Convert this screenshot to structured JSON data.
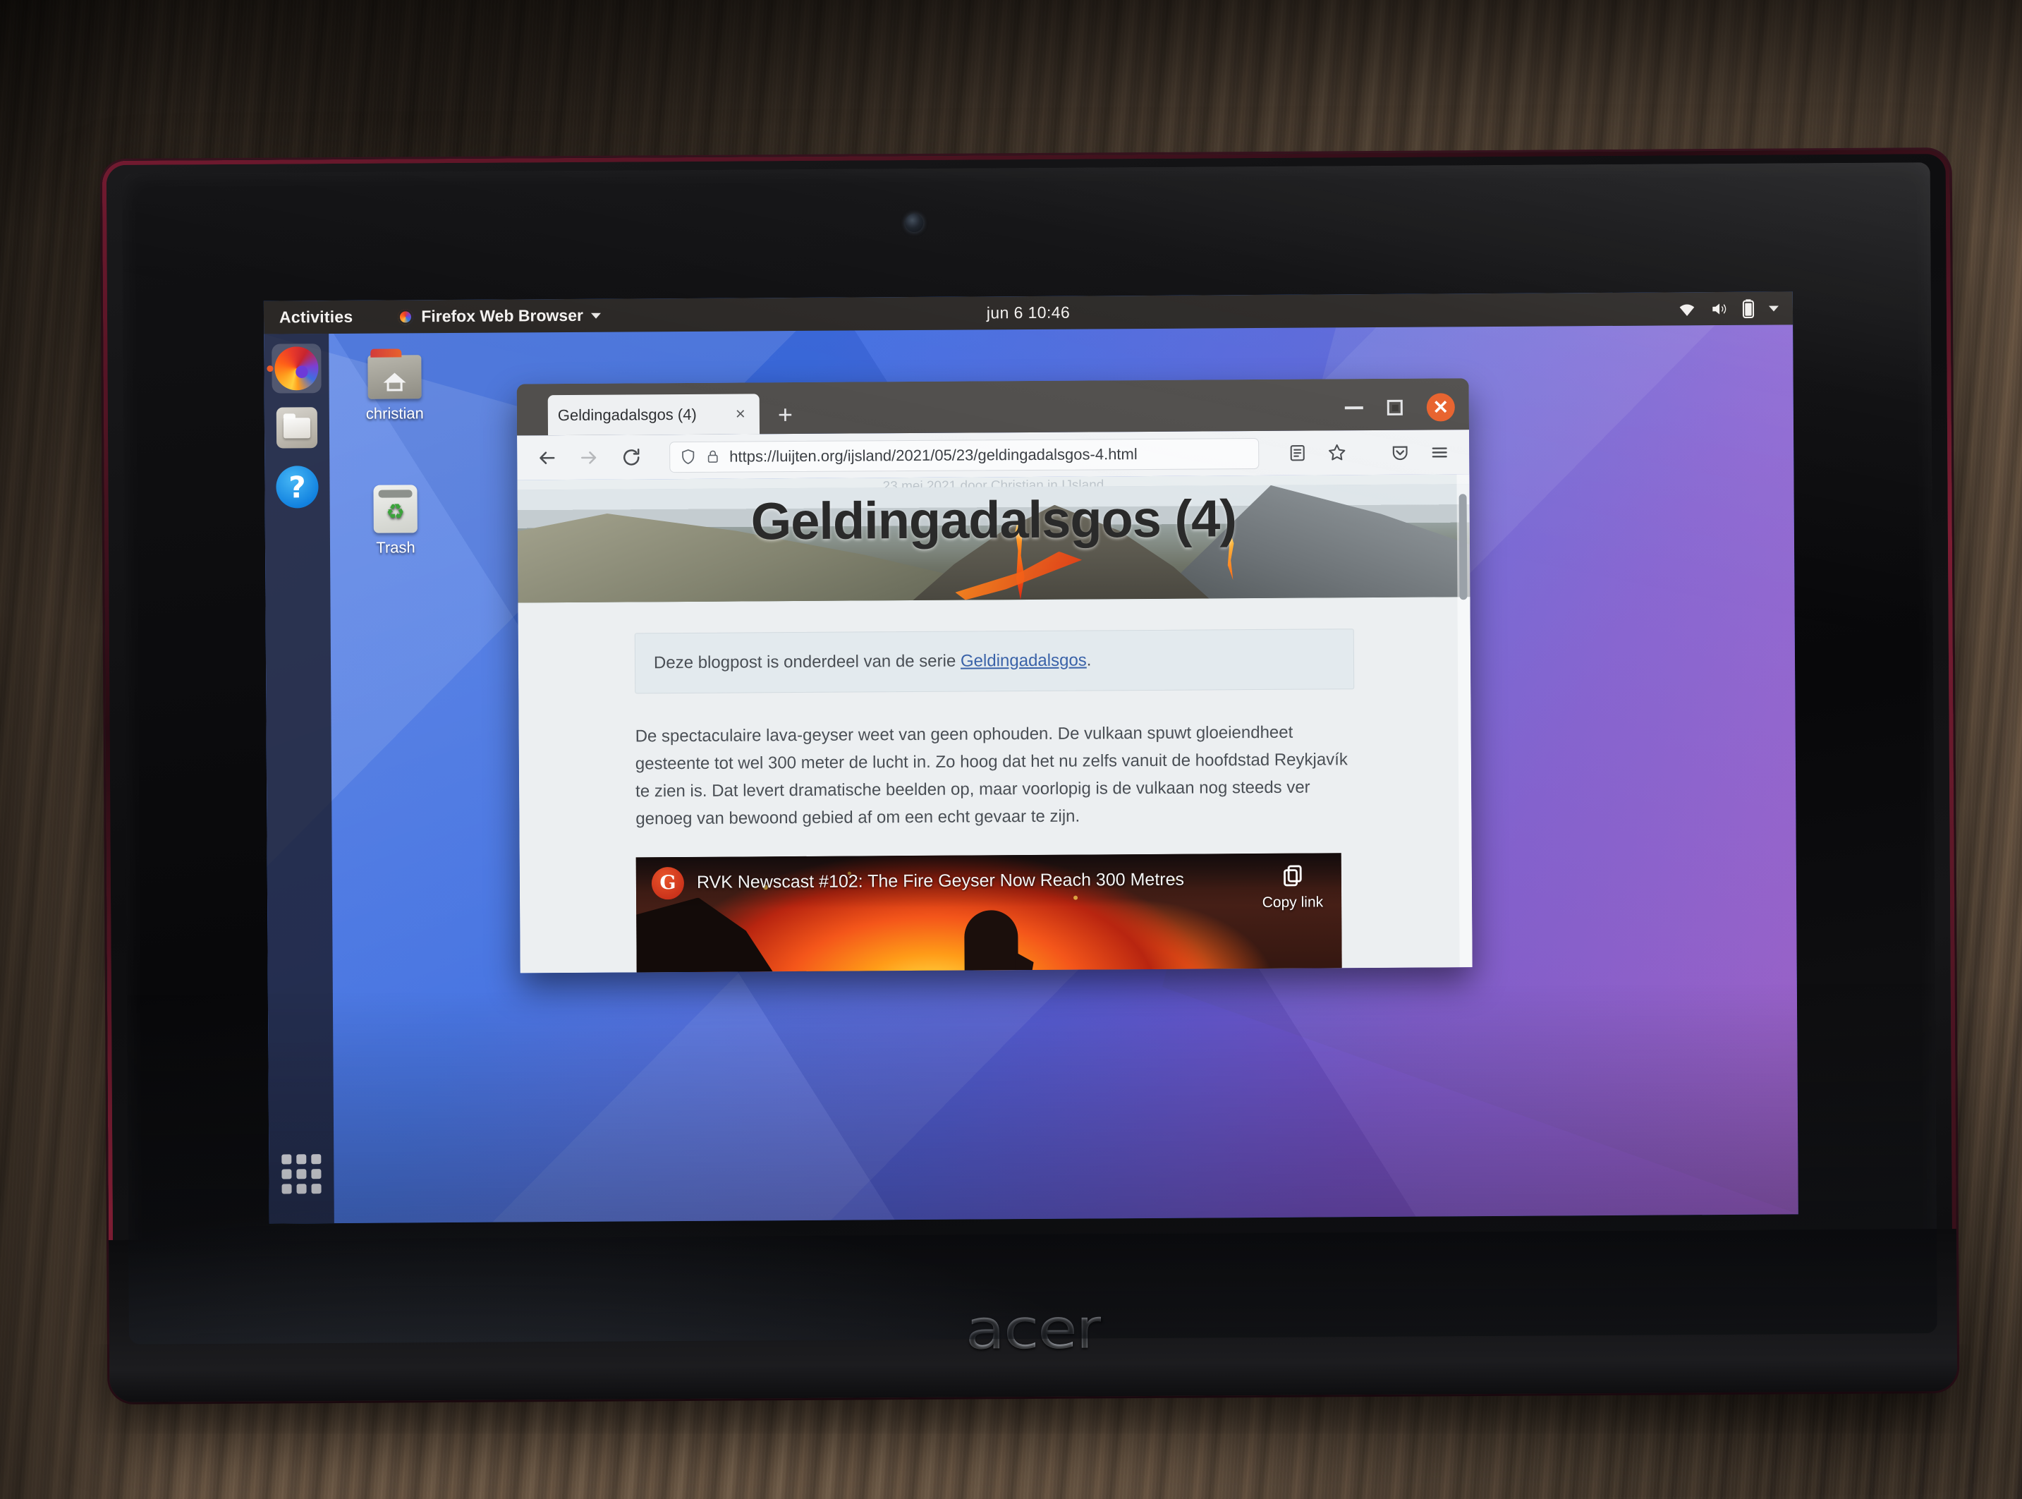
{
  "device": {
    "brand": "acer"
  },
  "desktop": {
    "topbar": {
      "activities": "Activities",
      "app_menu": "Firefox Web Browser",
      "clock": "jun 6  10:46",
      "icons": [
        "wifi-icon",
        "volume-icon",
        "battery-icon",
        "chevron-down-icon"
      ]
    },
    "dock": [
      {
        "name": "firefox",
        "label": "Firefox Web Browser",
        "active": true
      },
      {
        "name": "files",
        "label": "Files",
        "active": false
      },
      {
        "name": "help",
        "label": "Help",
        "active": false
      }
    ],
    "apps_button": "Show Applications",
    "icons": [
      {
        "name": "home-folder",
        "label": "christian"
      },
      {
        "name": "trash",
        "label": "Trash"
      }
    ]
  },
  "browser": {
    "tab": {
      "title": "Geldingadalsgos (4)",
      "close": "×"
    },
    "new_tab": "+",
    "window_buttons": {
      "minimize": "–",
      "maximize": "□",
      "close": "×"
    },
    "nav": {
      "back": "←",
      "forward": "→",
      "reload": "⟳"
    },
    "url": "https://luijten.org/ijsland/2021/05/23/geldingadalsgos-4.html",
    "url_icons": [
      "shield-icon",
      "lock-icon"
    ],
    "toolbar_icons": [
      "reader-mode-icon",
      "bookmark-star-icon",
      "pocket-icon",
      "hamburger-menu-icon"
    ]
  },
  "page": {
    "meta": "23 mei 2021 door Christian in IJsland",
    "title": "Geldingadalsgos (4)",
    "series_note_prefix": "Deze blogpost is onderdeel van de serie ",
    "series_link": "Geldingadalsgos",
    "series_note_suffix": ".",
    "paragraph": "De spectaculaire lava-geyser weet van geen ophouden. De vulkaan spuwt gloeiendheet gesteente tot wel 300 meter de lucht in. Zo hoog dat het nu zelfs vanuit de hoofdstad Reykjavík te zien is. Dat levert dramatische beelden op, maar voorlopig is de vulkaan nog steeds ver genoeg van bewoond gebied af om een echt gevaar te zijn.",
    "video": {
      "channel_badge": "G",
      "title": "RVK Newscast #102: The Fire Geyser Now Reach 300 Metres",
      "copy_link_label": "Copy link"
    }
  },
  "colors": {
    "accent_orange": "#e8622d",
    "topbar_bg": "#2b2826",
    "wallpaper_blue": "#3f6fe0",
    "link_blue": "#3a62a8"
  }
}
